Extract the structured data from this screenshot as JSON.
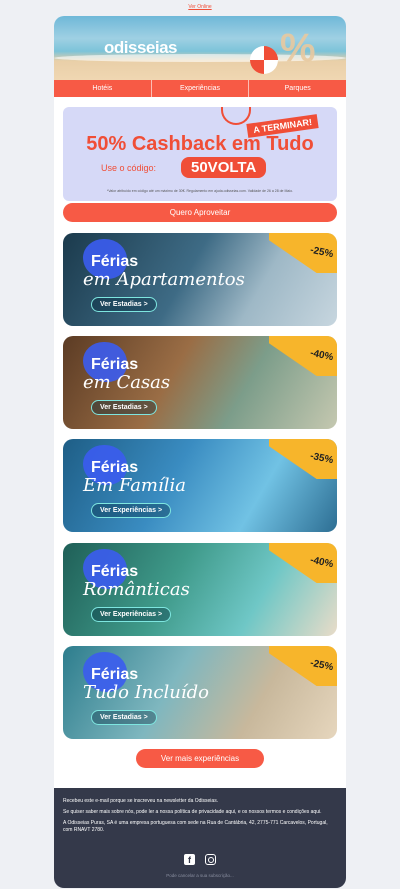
{
  "top_link": "Ver Online",
  "header": {
    "logo": "odisseias",
    "nav": [
      "Hotéis",
      "Experiências",
      "Parques"
    ]
  },
  "promo": {
    "tag": "A TERMINAR!",
    "headline": "50% Cashback em Tudo",
    "code_prefix": "Use o código:",
    "code": "50VOLTA",
    "fine_print": "*Valor atribuído em código até um máximo de 30€. Regulamento em ajuda.odisseias.com. Validade de 26 a 28 de Maio.",
    "button": "Quero Aproveitar"
  },
  "tiles": [
    {
      "title": "Férias",
      "subtitle": "em Apartamentos",
      "cta": "Ver Estadias >",
      "discount": "-25%"
    },
    {
      "title": "Férias",
      "subtitle": "em Casas",
      "cta": "Ver Estadias >",
      "discount": "-40%"
    },
    {
      "title": "Férias",
      "subtitle": "Em Família",
      "cta": "Ver Experiências >",
      "discount": "-35%"
    },
    {
      "title": "Férias",
      "subtitle": "Românticas",
      "cta": "Ver Experiências >",
      "discount": "-40%"
    },
    {
      "title": "Férias",
      "subtitle": "Tudo Incluído",
      "cta": "Ver Estadias >",
      "discount": "-25%"
    }
  ],
  "more_button": "Ver mais experiências",
  "footer": {
    "line1": "Recebeu este e-mail porque se inscreveu na newsletter da Odisseias.",
    "line2": "Se quiser saber mais sobre nós, pode ler a nossa política de privacidade aqui, e os nossos termos e condições aqui.",
    "line3": "A Odisseias Puras, SA é uma empresa portuguesa com sede na Rua de Cantábria, 42, 2775-771 Carcavelos, Portugal, com RNAVT 2780.",
    "cancel": "Pode cancelar a sua subscrição..."
  },
  "colors": {
    "accent": "#f75a45",
    "footer_bg": "#34394a",
    "promo_bg": "#d6d9f7",
    "discount": "#f7b52b"
  }
}
